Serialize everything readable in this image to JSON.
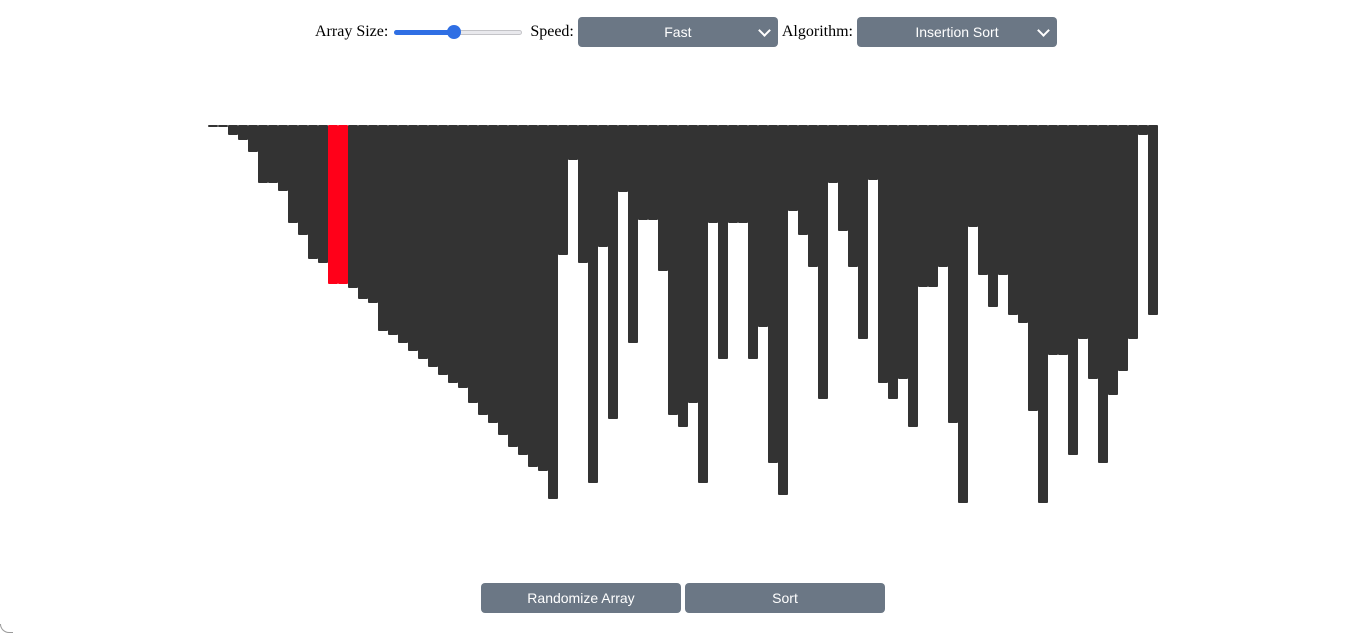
{
  "controls": {
    "array_size_label": "Array Size:",
    "array_size_value": 0.47,
    "speed_label": "Speed:",
    "speed_selected": "Fast",
    "algorithm_label": "Algorithm:",
    "algorithm_selected": "Insertion Sort"
  },
  "buttons": {
    "randomize_label": "Randomize Array",
    "sort_label": "Sort"
  },
  "colors": {
    "bar": "#333333",
    "bar_active": "#ff0019",
    "accent": "#2f6fe4",
    "control_bg": "#6b7785"
  },
  "chart_data": {
    "type": "bar",
    "orientation": "downward",
    "highlighted_indices": [
      12,
      13
    ],
    "values": [
      2,
      2,
      10,
      15,
      27,
      58,
      58,
      66,
      98,
      110,
      134,
      138,
      159,
      159,
      163,
      174,
      178,
      206,
      210,
      218,
      226,
      234,
      242,
      250,
      258,
      263,
      278,
      290,
      298,
      310,
      322,
      330,
      342,
      346,
      374,
      130,
      35,
      138,
      358,
      122,
      294,
      67,
      218,
      95,
      95,
      146,
      290,
      302,
      278,
      358,
      98,
      234,
      98,
      98,
      234,
      202,
      338,
      370,
      86,
      110,
      142,
      274,
      58,
      106,
      142,
      214,
      55,
      258,
      274,
      254,
      302,
      162,
      162,
      142,
      298,
      378,
      102,
      150,
      182,
      150,
      190,
      198,
      286,
      378,
      230,
      230,
      330,
      214,
      254,
      338,
      270,
      246,
      214,
      10,
      190
    ]
  }
}
